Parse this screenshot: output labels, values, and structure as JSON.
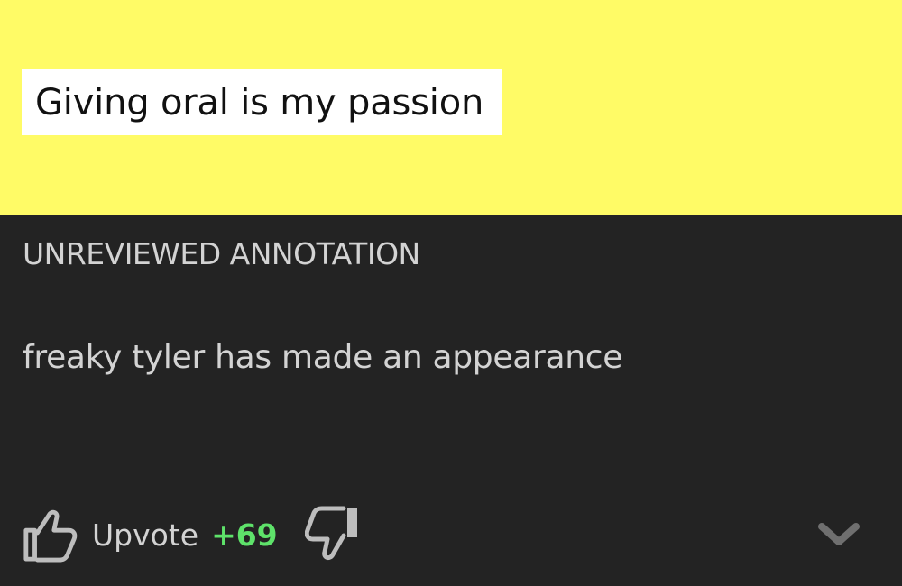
{
  "lyric": {
    "text": "Giving oral is my passion"
  },
  "annotation": {
    "status": "UNREVIEWED ANNOTATION",
    "body": "freaky tyler has made an appearance"
  },
  "voting": {
    "upvote_label": "Upvote",
    "score": "+69",
    "upvote_icon": "thumbs-up-icon",
    "downvote_icon": "thumbs-down-icon",
    "expand_icon": "chevron-down-icon"
  },
  "colors": {
    "lyric_highlight_background": "#fffb66",
    "panel_background": "#232323",
    "score_color": "#5ee26a",
    "text_color": "#d3d3d3"
  }
}
